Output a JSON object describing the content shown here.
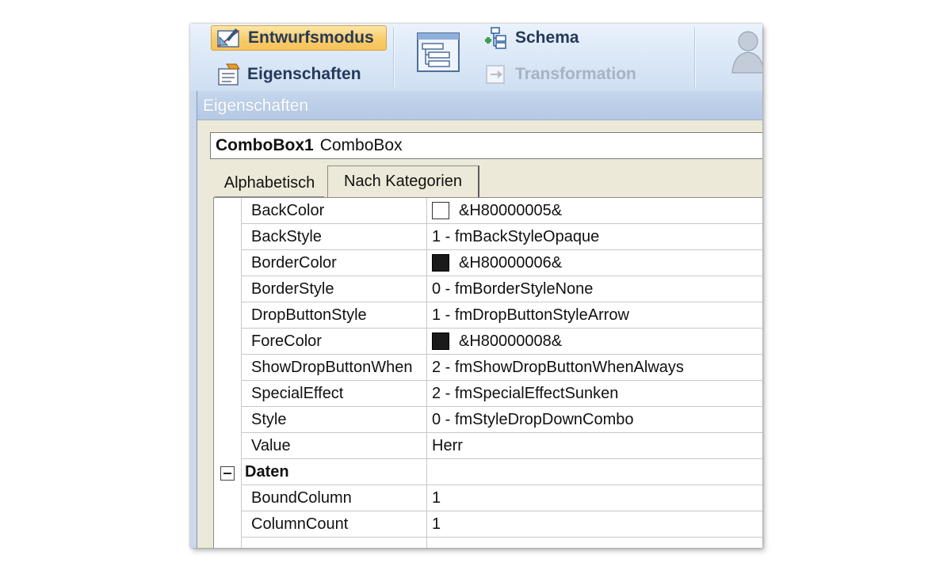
{
  "ribbon": {
    "design_mode_label": "Entwurfsmodus",
    "properties_label": "Eigenschaften",
    "schema_label": "Schema",
    "transformation_label": "Transformation",
    "colors": {
      "active_fill": "#f9cc6a",
      "disabled_text": "#a6b3c4"
    }
  },
  "properties_window": {
    "title": "Eigenschaften",
    "object_name": "ComboBox1",
    "object_type": "ComboBox",
    "tabs": [
      {
        "label": "Alphabetisch",
        "active": false
      },
      {
        "label": "Nach Kategorien",
        "active": true
      }
    ],
    "rows": [
      {
        "name": "BackColor",
        "value": "&H80000005&",
        "swatch": "#ffffff"
      },
      {
        "name": "BackStyle",
        "value": "1 - fmBackStyleOpaque"
      },
      {
        "name": "BorderColor",
        "value": "&H80000006&",
        "swatch": "#1a1a1a"
      },
      {
        "name": "BorderStyle",
        "value": "0 - fmBorderStyleNone"
      },
      {
        "name": "DropButtonStyle",
        "value": "1 - fmDropButtonStyleArrow"
      },
      {
        "name": "ForeColor",
        "value": "&H80000008&",
        "swatch": "#1a1a1a"
      },
      {
        "name": "ShowDropButtonWhen",
        "value": "2 - fmShowDropButtonWhenAlways"
      },
      {
        "name": "SpecialEffect",
        "value": "2 - fmSpecialEffectSunken"
      },
      {
        "name": "Style",
        "value": "0 - fmStyleDropDownCombo"
      },
      {
        "name": "Value",
        "value": "Herr"
      },
      {
        "name": "Daten",
        "value": "",
        "category": true,
        "expanded": true
      },
      {
        "name": "BoundColumn",
        "value": "1"
      },
      {
        "name": "ColumnCount",
        "value": "1"
      }
    ]
  }
}
